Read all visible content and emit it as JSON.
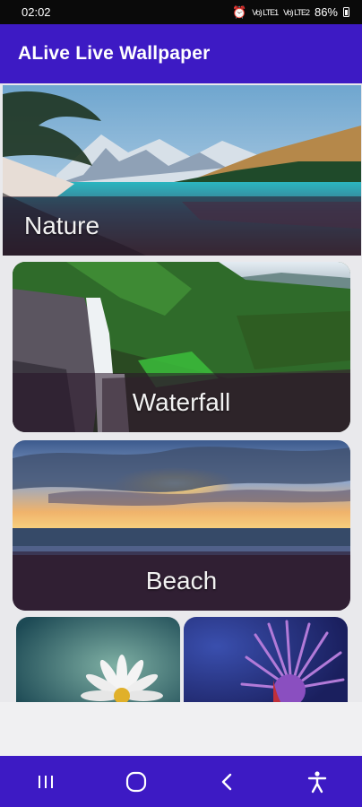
{
  "status_bar": {
    "time": "02:02",
    "signal1": "Vo) LTE1",
    "signal2": "Vo) LTE2",
    "battery": "86%"
  },
  "app_bar": {
    "title": "ALive Live Wallpaper"
  },
  "categories": [
    {
      "label": "Nature"
    },
    {
      "label": "Waterfall"
    },
    {
      "label": "Beach"
    },
    {
      "label": ""
    },
    {
      "label": ""
    }
  ],
  "nav": {
    "recents_icon": "recents-icon",
    "home_icon": "home-icon",
    "back_icon": "back-icon",
    "accessibility_icon": "accessibility-icon"
  },
  "colors": {
    "app_bar": "#3d1ac4",
    "status_bar": "#0a0a0a",
    "background": "#e9e9ec"
  }
}
